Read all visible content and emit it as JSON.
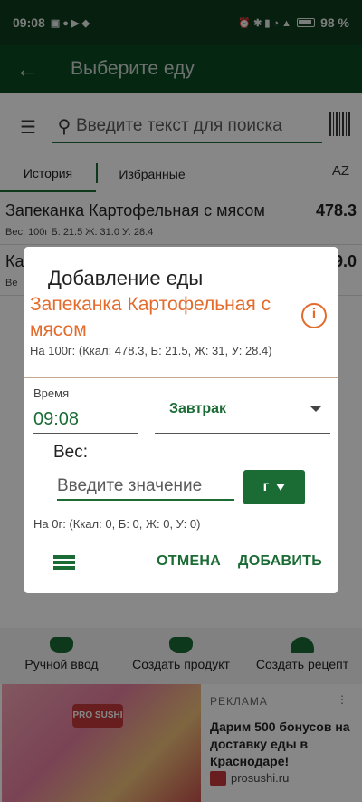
{
  "status_bar": {
    "time": "09:08",
    "battery_pct": "98 %"
  },
  "app_bar": {
    "title": "Выберите еду"
  },
  "search": {
    "placeholder": "Введите текст для поиска"
  },
  "tabs": [
    {
      "label": "История"
    },
    {
      "label": "Избранные"
    }
  ],
  "sort_label": "AZ",
  "food_list": [
    {
      "name": "Запеканка Картофельная с мясом",
      "kcal": "478.3",
      "macros": "Вес: 100г   Б: 21.5   Ж: 31.0   У: 28.4"
    },
    {
      "name": "Ка",
      "kcal": "9.0",
      "macros": "Ве"
    }
  ],
  "bottom_actions": [
    {
      "label": "Ручной ввод"
    },
    {
      "label": "Создать продукт"
    },
    {
      "label": "Создать рецепт"
    }
  ],
  "ad": {
    "label": "РЕКЛАМА",
    "logo_text": "PRO SUSHI",
    "text": "Дарим 500 бонусов на доставку еды в Краснодаре!",
    "brand": "prosushi.ru"
  },
  "dialog": {
    "title": "Добавление еды",
    "food_name": "Запеканка Картофельная с мясом",
    "per_100": "На 100г: (Ккал: 478.3, Б: 21.5, Ж: 31, У: 28.4)",
    "time_label": "Время",
    "time_value": "09:08",
    "meal_value": "Завтрак",
    "weight_label": "Вес:",
    "weight_placeholder": "Введите значение",
    "unit": "г",
    "zero_line": "На 0г: (Ккал: 0, Б: 0, Ж: 0, У: 0)",
    "cancel_label": "ОТМЕНА",
    "add_label": "ДОБАВИТЬ"
  },
  "colors": {
    "accent": "#1b6b35",
    "orange": "#e36b2c",
    "appbar": "#0b4a22"
  }
}
